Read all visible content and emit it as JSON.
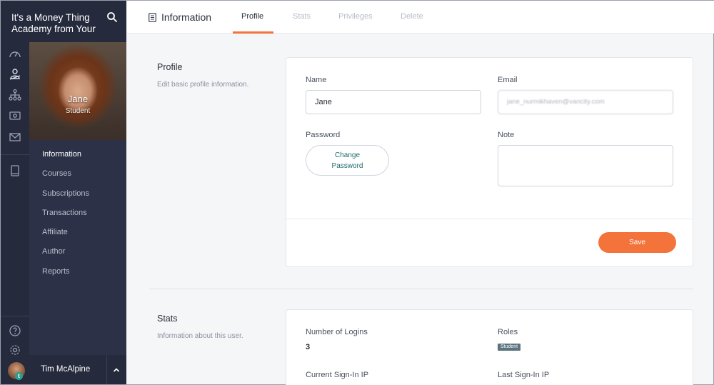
{
  "app": {
    "title": "It's a Money Thing Academy from Your"
  },
  "profile": {
    "name": "Jane",
    "role": "Student"
  },
  "sidebar": {
    "items": [
      {
        "label": "Information",
        "active": true
      },
      {
        "label": "Courses"
      },
      {
        "label": "Subscriptions"
      },
      {
        "label": "Transactions"
      },
      {
        "label": "Affiliate"
      },
      {
        "label": "Author"
      },
      {
        "label": "Reports"
      }
    ]
  },
  "rail_icons": [
    "dashboard-icon",
    "users-icon",
    "sitemap-icon",
    "money-icon",
    "mail-icon",
    "book-icon",
    "help-icon",
    "settings-icon"
  ],
  "user": {
    "name": "Tim McAlpine",
    "badge": "t"
  },
  "header": {
    "title": "Information",
    "tabs": [
      {
        "label": "Profile",
        "active": true
      },
      {
        "label": "Stats"
      },
      {
        "label": "Privileges"
      },
      {
        "label": "Delete"
      }
    ]
  },
  "profile_section": {
    "title": "Profile",
    "description": "Edit basic profile information.",
    "name_label": "Name",
    "name_value": "Jane",
    "email_label": "Email",
    "email_value": "jane_nurmikhaven@vancity.com",
    "password_label": "Password",
    "change_password_line1": "Change",
    "change_password_line2": "Password",
    "note_label": "Note",
    "note_value": "",
    "save_label": "Save"
  },
  "stats_section": {
    "title": "Stats",
    "description": "Information about this user.",
    "logins_label": "Number of Logins",
    "logins_value": "3",
    "roles_label": "Roles",
    "role_badge": "Student",
    "current_ip_label": "Current Sign-In IP",
    "last_ip_label": "Last Sign-In IP"
  },
  "colors": {
    "accent": "#f4733a",
    "sidebar": "#2d3147",
    "rail": "#262a3d",
    "badge": "#5b7480"
  }
}
